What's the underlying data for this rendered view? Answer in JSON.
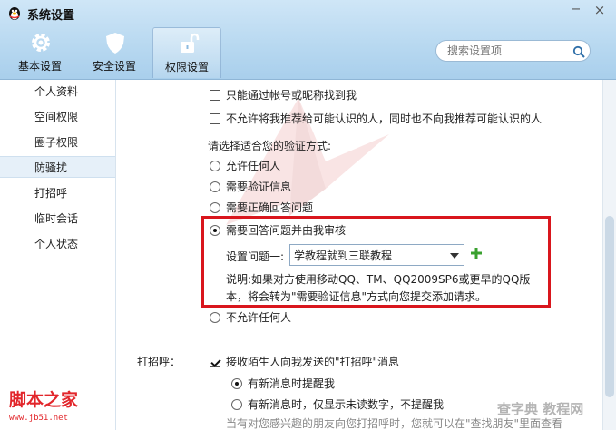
{
  "window": {
    "title": "系统设置",
    "minimize_glyph": "−",
    "close_glyph": "×"
  },
  "tabs": [
    {
      "label": "基本设置",
      "icon": "gear-icon"
    },
    {
      "label": "安全设置",
      "icon": "shield-icon"
    },
    {
      "label": "权限设置",
      "icon": "unlock-icon",
      "active": true
    }
  ],
  "search": {
    "placeholder": "搜索设置项"
  },
  "sidebar": {
    "items": [
      {
        "label": "个人资料"
      },
      {
        "label": "空间权限"
      },
      {
        "label": "圈子权限"
      },
      {
        "label": "防骚扰",
        "active": true
      },
      {
        "label": "打招呼"
      },
      {
        "label": "临时会话"
      },
      {
        "label": "个人状态"
      }
    ]
  },
  "main": {
    "find_options": [
      {
        "label": "只能通过帐号或昵称找到我",
        "checked": false
      },
      {
        "label": "不允许将我推荐给可能认识的人，同时也不向我推荐可能认识的人",
        "checked": false
      }
    ],
    "verify_heading": "请选择适合您的验证方式:",
    "verify_options": [
      {
        "label": "允许任何人",
        "checked": false
      },
      {
        "label": "需要验证信息",
        "checked": false
      },
      {
        "label": "需要正确回答问题",
        "checked": false
      },
      {
        "label": "需要回答问题并由我审核",
        "checked": true
      },
      {
        "label": "不允许任何人",
        "checked": false
      }
    ],
    "question": {
      "label": "设置问题一:",
      "value": "学教程就到三联教程"
    },
    "note": "说明:如果对方使用移动QQ、TM、QQ2009SP6或更早的QQ版本，将会转为\"需要验证信息\"方式向您提交添加请求。",
    "greet": {
      "label": "打招呼：",
      "accept_label": "接收陌生人向我发送的\"打招呼\"消息",
      "accept_checked": true,
      "options": [
        {
          "label": "有新消息时提醒我",
          "checked": true
        },
        {
          "label": "有新消息时，仅显示未读数字，不提醒我",
          "checked": false
        }
      ],
      "footer_note": "当有对您感兴趣的朋友向您打招呼时，您就可以在\"查找朋友\"里面查看"
    }
  },
  "watermarks": {
    "left_logo": "脚本之家",
    "left_url": "www.jb51.net",
    "right_logo": "查字典 教程网"
  },
  "colors": {
    "highlight": "#d9161d",
    "header": "#b7d8f0",
    "active_item": "#e6f0f9",
    "add_icon": "#3aa12f"
  }
}
